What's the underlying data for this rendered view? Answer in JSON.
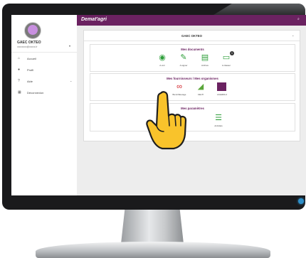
{
  "header": {
    "brand": "Demat'agri"
  },
  "sidebar": {
    "farm_name": "GAEC OKTEO",
    "user_email": "xxxxxxxx@xxxxx.fr",
    "items": [
      {
        "label": "Accueil",
        "icon": "home-icon"
      },
      {
        "label": "Profil",
        "icon": "user-icon"
      },
      {
        "label": "Aide",
        "icon": "help-icon"
      },
      {
        "label": "Déconnexion",
        "icon": "grid-icon"
      }
    ]
  },
  "main": {
    "farm_selector": "GAEC OKTEO",
    "documents": {
      "title": "Mes documents",
      "tiles": [
        {
          "label": "A voir",
          "icon": "eye-icon"
        },
        {
          "label": "A signer",
          "icon": "pencil-icon"
        },
        {
          "label": "Archive",
          "icon": "archive-icon"
        },
        {
          "label": "A classer",
          "icon": "folder-icon",
          "badge": "1"
        }
      ]
    },
    "suppliers": {
      "title": "Mes fournisseurs / Mes organismes",
      "tiles": [
        {
          "label": "Bovin'Elevage",
          "icon": "supplier-logo-red"
        },
        {
          "label": "CELTI",
          "icon": "supplier-logo-green"
        },
        {
          "label": "LIGERIA 2",
          "icon": "supplier-logo-purple"
        }
      ]
    },
    "settings": {
      "title": "Mes paramètres",
      "tiles": [
        {
          "label": "Activités",
          "icon": "list-icon"
        }
      ]
    }
  },
  "colors": {
    "brand": "#6b2261",
    "accent": "#2e9e3a"
  }
}
